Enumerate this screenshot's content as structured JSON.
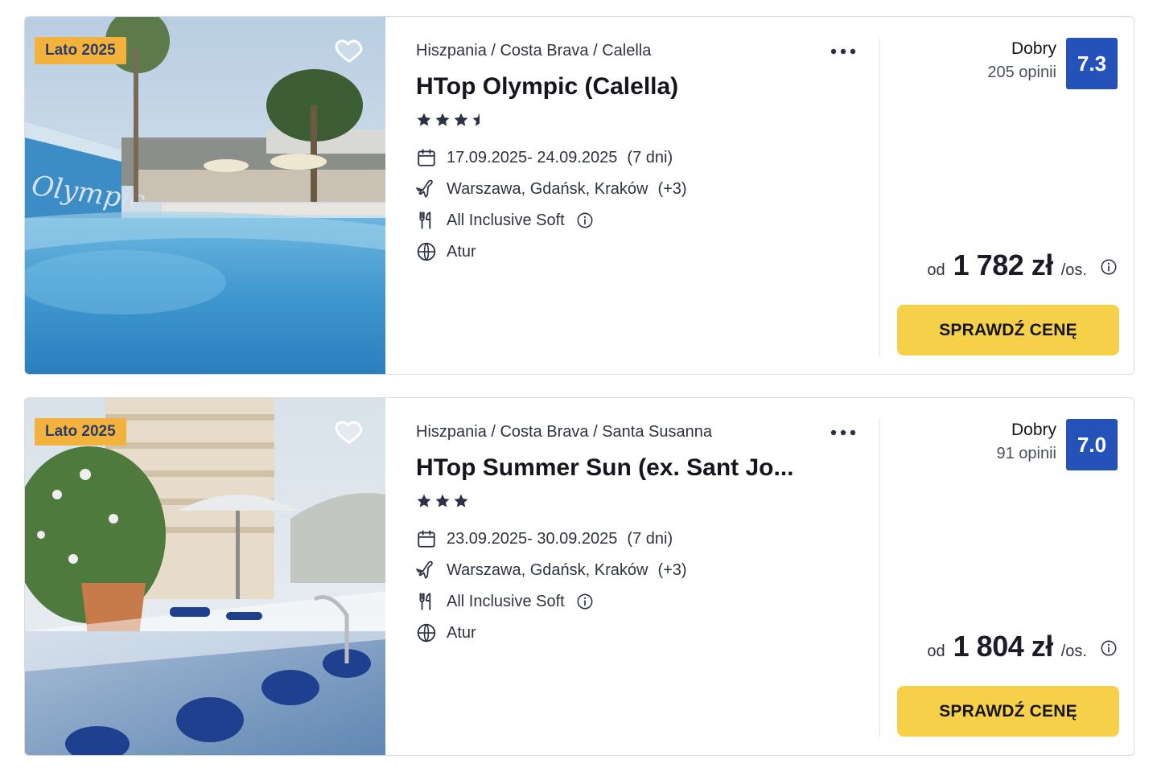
{
  "offers": [
    {
      "badge": "Lato 2025",
      "breadcrumb": "Hiszpania / Costa Brava / Calella",
      "hotel_name": "HTop Olympic (Calella)",
      "stars": 3.5,
      "dates": "17.09.2025- 24.09.2025",
      "duration": "(7 dni)",
      "departure": "Warszawa, Gdańsk, Kraków",
      "departure_extra": "(+3)",
      "board": "All Inclusive Soft",
      "organizer": "Atur",
      "rating_label": "Dobry",
      "rating_count": "205 opinii",
      "rating_score": "7.3",
      "price_prefix": "od",
      "price": "1 782 zł",
      "price_suffix": "/os.",
      "cta_label": "SPRAWDŹ CENĘ"
    },
    {
      "badge": "Lato 2025",
      "breadcrumb": "Hiszpania / Costa Brava / Santa Susanna",
      "hotel_name": "HTop Summer Sun (ex. Sant Jo...",
      "stars": 3,
      "dates": "23.09.2025- 30.09.2025",
      "duration": "(7 dni)",
      "departure": "Warszawa, Gdańsk, Kraków",
      "departure_extra": "(+3)",
      "board": "All Inclusive Soft",
      "organizer": "Atur",
      "rating_label": "Dobry",
      "rating_count": "91 opinii",
      "rating_score": "7.0",
      "price_prefix": "od",
      "price": "1 804 zł",
      "price_suffix": "/os.",
      "cta_label": "SPRAWDŹ CENĘ"
    }
  ],
  "colors": {
    "badge": "#f3b23c",
    "score": "#2452b8",
    "cta": "#f6d049",
    "star": "#2b3246"
  },
  "icons": [
    "heart-icon",
    "more-dots-icon",
    "star-icon",
    "calendar-icon",
    "plane-icon",
    "cutlery-icon",
    "info-icon",
    "globe-icon"
  ]
}
